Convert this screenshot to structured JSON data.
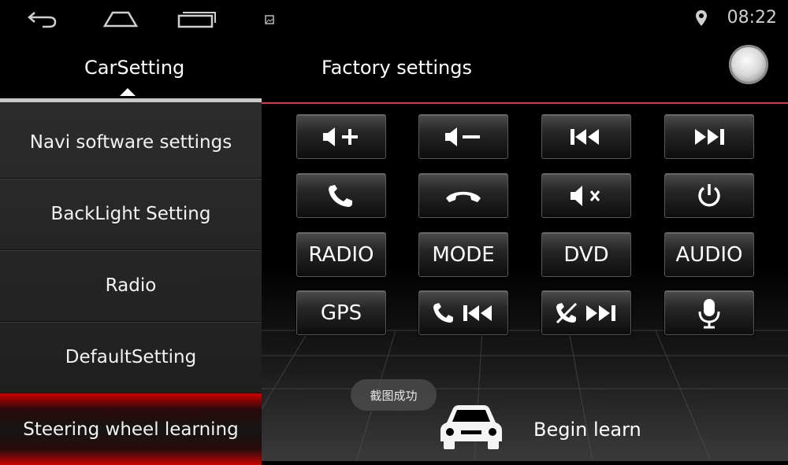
{
  "status_bar": {
    "time": "08:22",
    "icons": [
      "back-icon",
      "home-icon",
      "recent-apps-icon",
      "notification-image-icon",
      "location-pin-icon"
    ]
  },
  "tabs": {
    "car_setting": "CarSetting",
    "factory_settings": "Factory settings"
  },
  "sidebar": {
    "items": [
      {
        "label": "Navi software settings"
      },
      {
        "label": "BackLight Setting"
      },
      {
        "label": "Radio"
      },
      {
        "label": "DefaultSetting"
      },
      {
        "label": "Steering wheel learning",
        "active": true
      }
    ]
  },
  "keys": [
    {
      "name": "volume-up",
      "icon": "volume-up-icon"
    },
    {
      "name": "volume-down",
      "icon": "volume-down-icon"
    },
    {
      "name": "previous-track",
      "icon": "previous-track-icon"
    },
    {
      "name": "next-track",
      "icon": "next-track-icon"
    },
    {
      "name": "answer-call",
      "icon": "phone-answer-icon"
    },
    {
      "name": "hang-up",
      "icon": "phone-hangup-icon"
    },
    {
      "name": "mute",
      "icon": "mute-icon"
    },
    {
      "name": "power",
      "icon": "power-icon"
    },
    {
      "name": "radio",
      "label": "RADIO"
    },
    {
      "name": "mode",
      "label": "MODE"
    },
    {
      "name": "dvd",
      "label": "DVD"
    },
    {
      "name": "audio",
      "label": "AUDIO"
    },
    {
      "name": "gps",
      "label": "GPS"
    },
    {
      "name": "call-previous",
      "icon": "phone-previous-icon"
    },
    {
      "name": "hangup-next",
      "icon": "phone-hangup-next-icon"
    },
    {
      "name": "voice",
      "icon": "microphone-icon"
    }
  ],
  "toast": "截图成功",
  "begin_learn": "Begin learn",
  "colors": {
    "accent": "#d9364d",
    "active_highlight": "#cc0000"
  }
}
